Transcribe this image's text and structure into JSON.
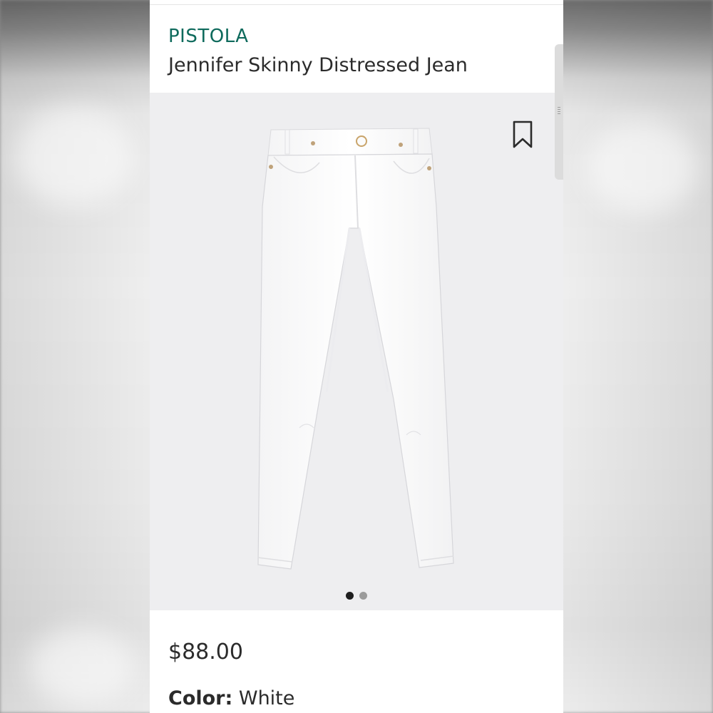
{
  "product": {
    "brand": "PISTOLA",
    "title": "Jennifer Skinny Distressed Jean",
    "price": "$88.00",
    "color_label": "Color:",
    "color_value": "White"
  },
  "gallery": {
    "current_image": 1,
    "image_count": 2
  },
  "icons": {
    "bookmark": "bookmark-icon"
  },
  "colors": {
    "brand": "#0e6a5c",
    "text": "#2b2b2b",
    "image_background": "#eeeef0",
    "dot_active": "#1e1e1e",
    "dot_inactive": "#9b9b9b"
  }
}
